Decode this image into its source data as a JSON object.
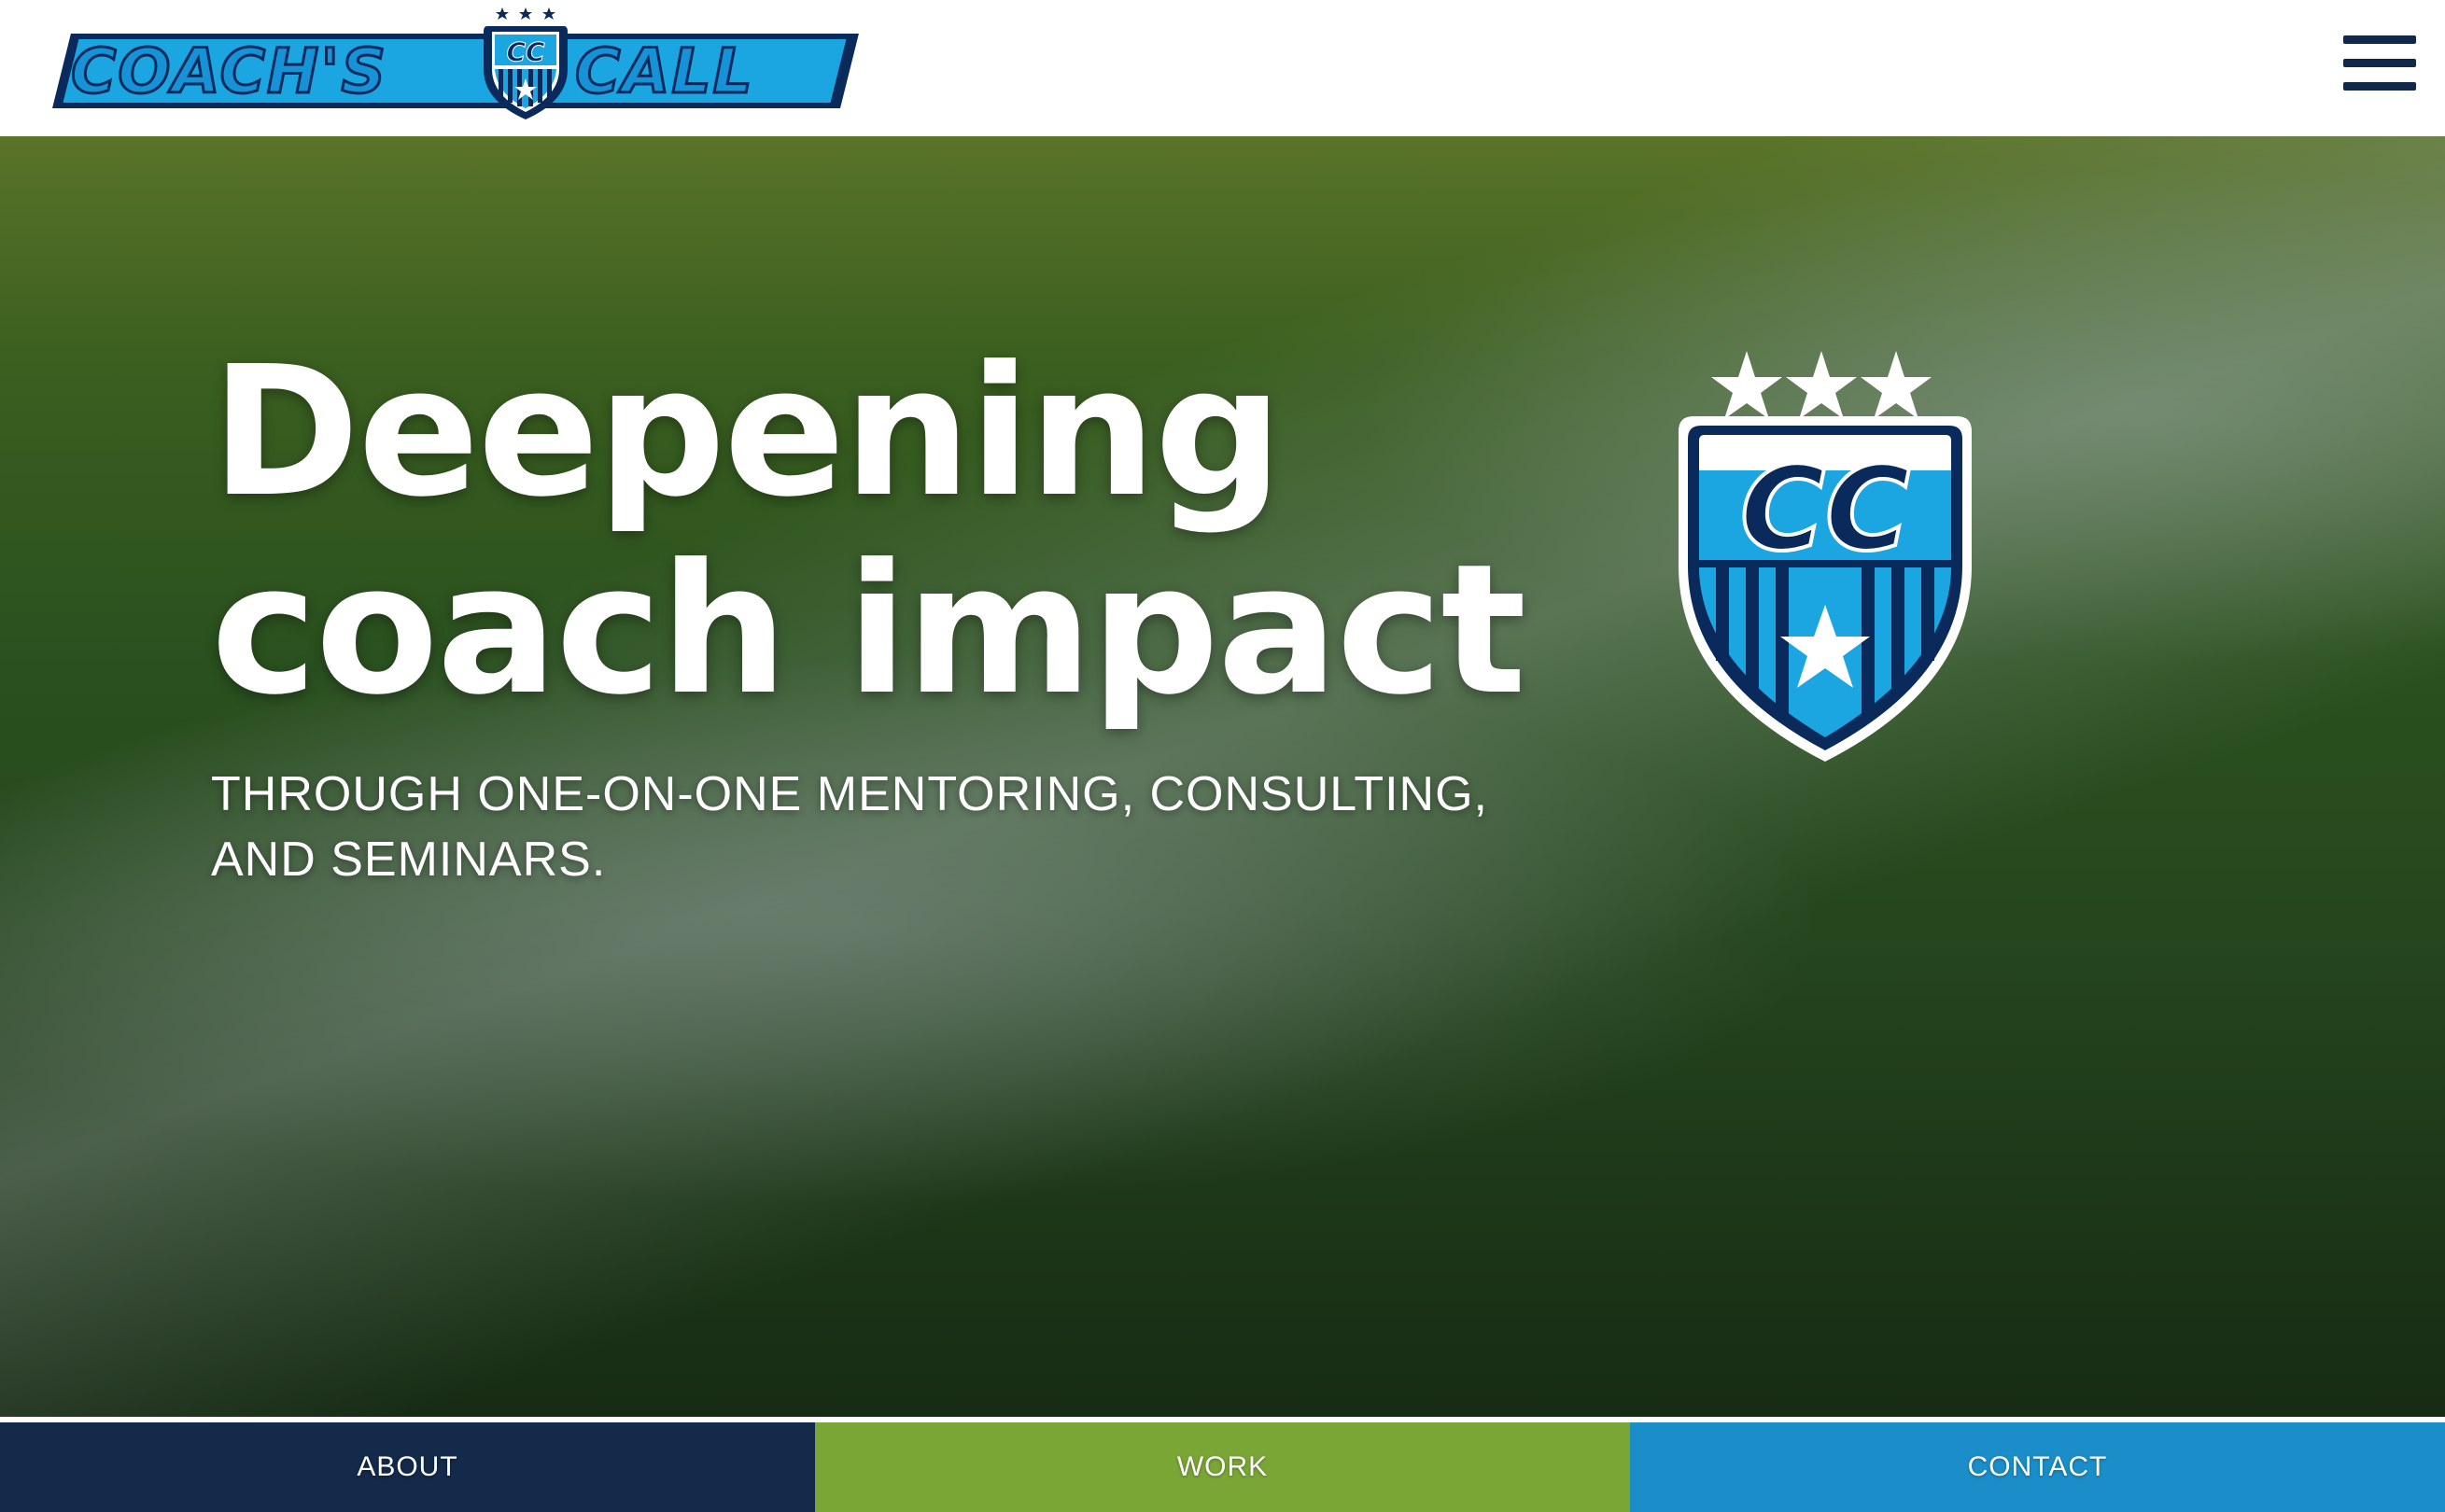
{
  "header": {
    "logo": {
      "left_word": "COACH'S",
      "right_word": "CALL",
      "badge_letters": "CC"
    },
    "menu_icon": "hamburger-menu-icon"
  },
  "hero": {
    "title_line1": "Deepening",
    "title_line2": "coach impact",
    "subtitle": "THROUGH ONE-ON-ONE MENTORING, CONSULTING, AND SEMINARS.",
    "badge_letters": "CC",
    "background": "soccer-field-grass"
  },
  "bottom_nav": {
    "items": [
      {
        "label": "ABOUT",
        "color": "#132a4b"
      },
      {
        "label": "WORK",
        "color": "#7aa636"
      },
      {
        "label": "CONTACT",
        "color": "#1b8ec9"
      }
    ]
  },
  "colors": {
    "navy": "#0b2a5c",
    "brand_blue": "#1ba6e2",
    "white": "#ffffff"
  }
}
